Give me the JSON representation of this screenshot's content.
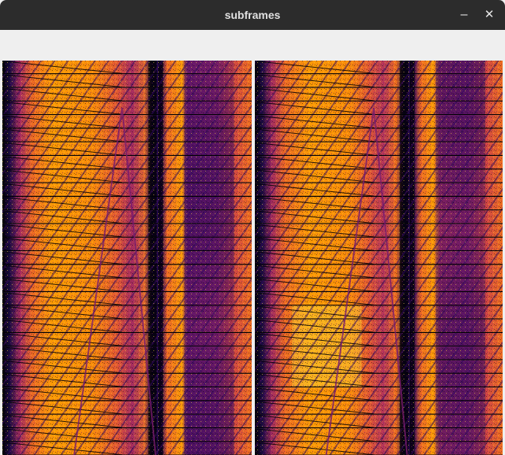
{
  "window": {
    "title": "subframes",
    "minimize_glyph": "–",
    "close_glyph": "✕"
  },
  "figure": {
    "colormap": "inferno",
    "panels": 2,
    "rows_per_panel": 30,
    "colors": {
      "black": "#000004",
      "dark_purple": "#320a5e",
      "purple": "#781c6d",
      "magenta": "#a52c60",
      "red_orange": "#cf4446",
      "orange": "#ed6925",
      "light_orange": "#fb9a06",
      "yellow": "#f7d03c"
    }
  }
}
